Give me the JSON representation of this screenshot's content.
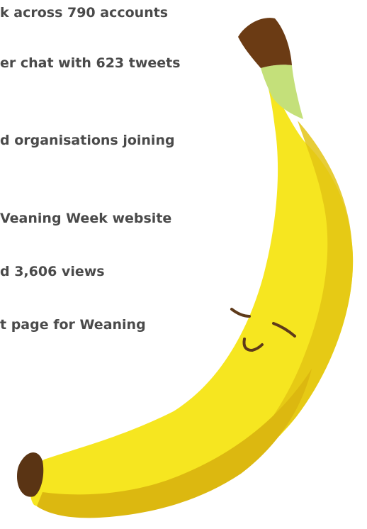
{
  "stats": [
    "k across 790 accounts",
    "er chat with 623 tweets",
    "d organisations joining",
    "Veaning Week website",
    "d 3,606 views",
    "t page for Weaning"
  ],
  "colors": {
    "text": "#4a4a4a",
    "banana_body": "#f6e620",
    "banana_shadow": "#e0c412",
    "banana_highlight": "#f4d618",
    "stem_green": "#c4e07a",
    "stem_tip": "#6b3b14",
    "bottom_tip": "#5a3414",
    "face": "#5e3a1a"
  },
  "icons": {
    "illustration": "banana-character-icon"
  }
}
